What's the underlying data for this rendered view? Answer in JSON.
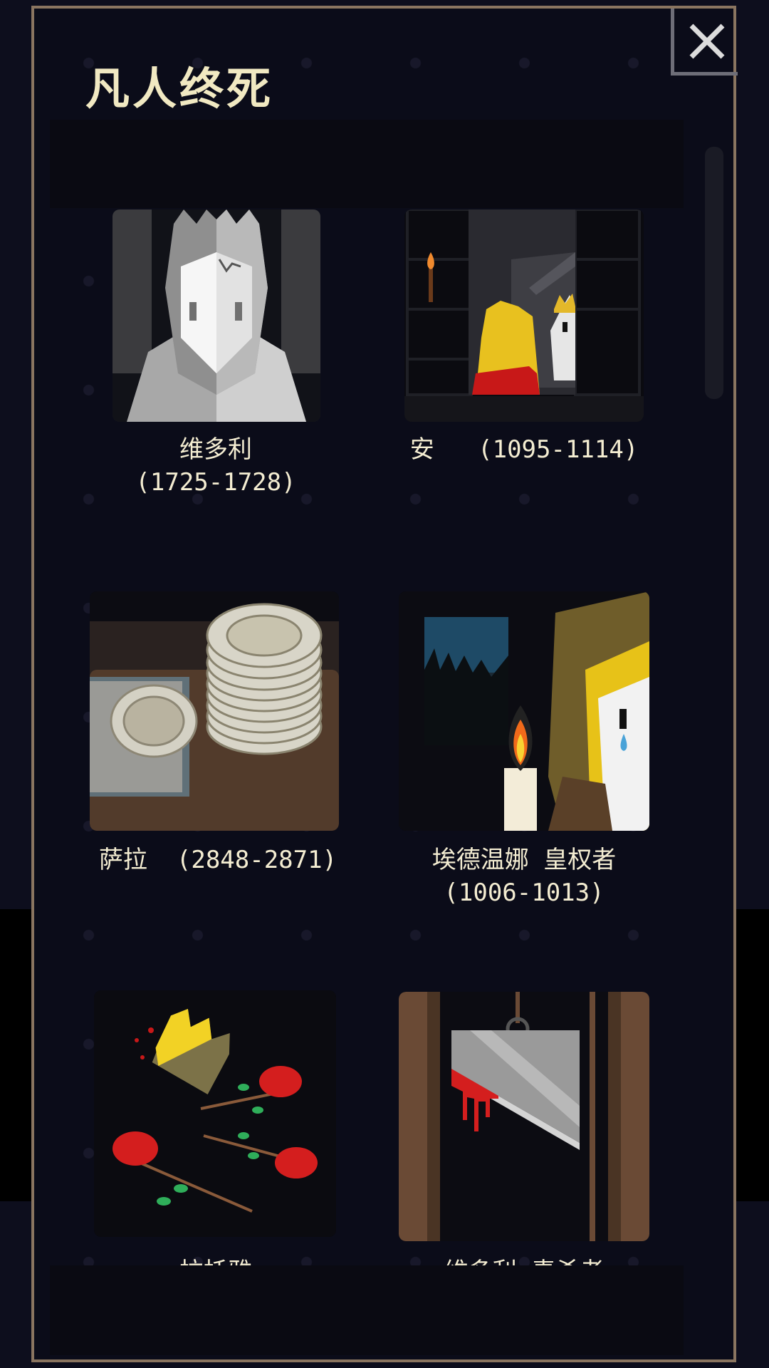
{
  "dialog": {
    "title": "凡人终死",
    "close_icon": "close-icon"
  },
  "deaths": [
    {
      "name": "维多利",
      "years": "(1725-1728)",
      "icon": "stone-queen-portrait"
    },
    {
      "name": "安",
      "years": "(1095-1114)",
      "icon": "mirror-skeleton-portrait"
    },
    {
      "name": "萨拉",
      "years": "(2848-2871)",
      "icon": "plates-stack-portrait"
    },
    {
      "name": "埃德温娜 皇权者",
      "years": "(1006-1013)",
      "icon": "candle-weeping-portrait"
    },
    {
      "name": "拉托雅",
      "years": "",
      "icon": "crown-roses-portrait"
    },
    {
      "name": "维多利 毒杀者",
      "years": "",
      "icon": "guillotine-portrait"
    }
  ],
  "colors": {
    "background": "#0b0c19",
    "border": "#8a7560",
    "title_text": "#f1e9c2",
    "caption_text": "#f4edd2"
  }
}
